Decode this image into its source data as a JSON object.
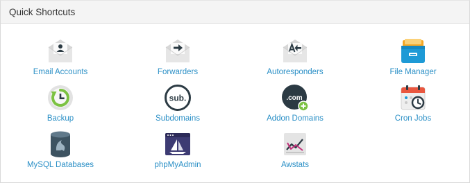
{
  "panel": {
    "title": "Quick Shortcuts"
  },
  "shortcuts": [
    {
      "label": "Email Accounts",
      "icon": "email-accounts-icon"
    },
    {
      "label": "Forwarders",
      "icon": "forwarders-icon"
    },
    {
      "label": "Autoresponders",
      "icon": "autoresponders-icon"
    },
    {
      "label": "File Manager",
      "icon": "file-manager-icon"
    },
    {
      "label": "Backup",
      "icon": "backup-icon"
    },
    {
      "label": "Subdomains",
      "icon": "subdomains-icon"
    },
    {
      "label": "Addon Domains",
      "icon": "addon-domains-icon"
    },
    {
      "label": "Cron Jobs",
      "icon": "cron-jobs-icon"
    },
    {
      "label": "MySQL Databases",
      "icon": "mysql-databases-icon"
    },
    {
      "label": "phpMyAdmin",
      "icon": "phpmyadmin-icon"
    },
    {
      "label": "Awstats",
      "icon": "awstats-icon"
    }
  ],
  "icon_text": {
    "subdomains": "sub.",
    "addon": ".com"
  },
  "colors": {
    "link": "#2a8fc6",
    "envelope": "#d9d9d9",
    "dark": "#2b3a43",
    "file_blue": "#1e9ad6",
    "file_orange": "#f5a623",
    "green": "#7cc242",
    "purple": "#3d3b73"
  }
}
